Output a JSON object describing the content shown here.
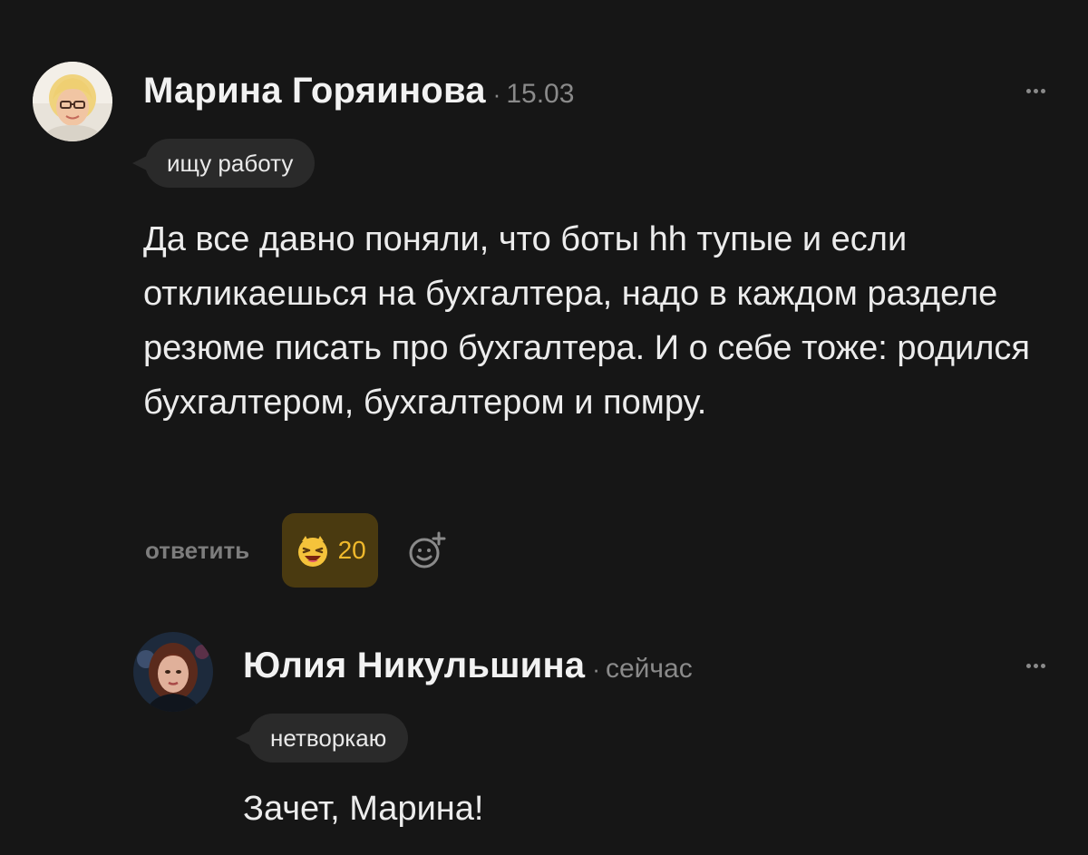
{
  "comments": [
    {
      "author": "Марина Горяинова",
      "separator": "·",
      "time": "15.03",
      "status": "ищу работу",
      "text": "Да все давно поняли, что боты hh тупые и если откликаешься на бухгалтера, надо в каждом разделе резюме писать про бухгалтера. И о себе тоже: родился бухгалтером, бухгалтером и помру.",
      "reply_label": "ответить",
      "reaction": {
        "icon": "laughing-emoji-icon",
        "count": "20"
      },
      "add_reaction_icon": "add-emoji-icon",
      "more_icon": "more-dots-icon"
    },
    {
      "author": "Юлия Никульшина",
      "separator": "·",
      "time": "сейчас",
      "status": "нетворкаю",
      "text": "Зачет, Марина!",
      "more_icon": "more-dots-icon"
    }
  ],
  "colors": {
    "background": "#161616",
    "text": "#ececec",
    "muted": "#8a8a8a",
    "pill": "#2a2a2a",
    "reaction_bg": "#4a3a10",
    "reaction_text": "#f0b92c"
  }
}
